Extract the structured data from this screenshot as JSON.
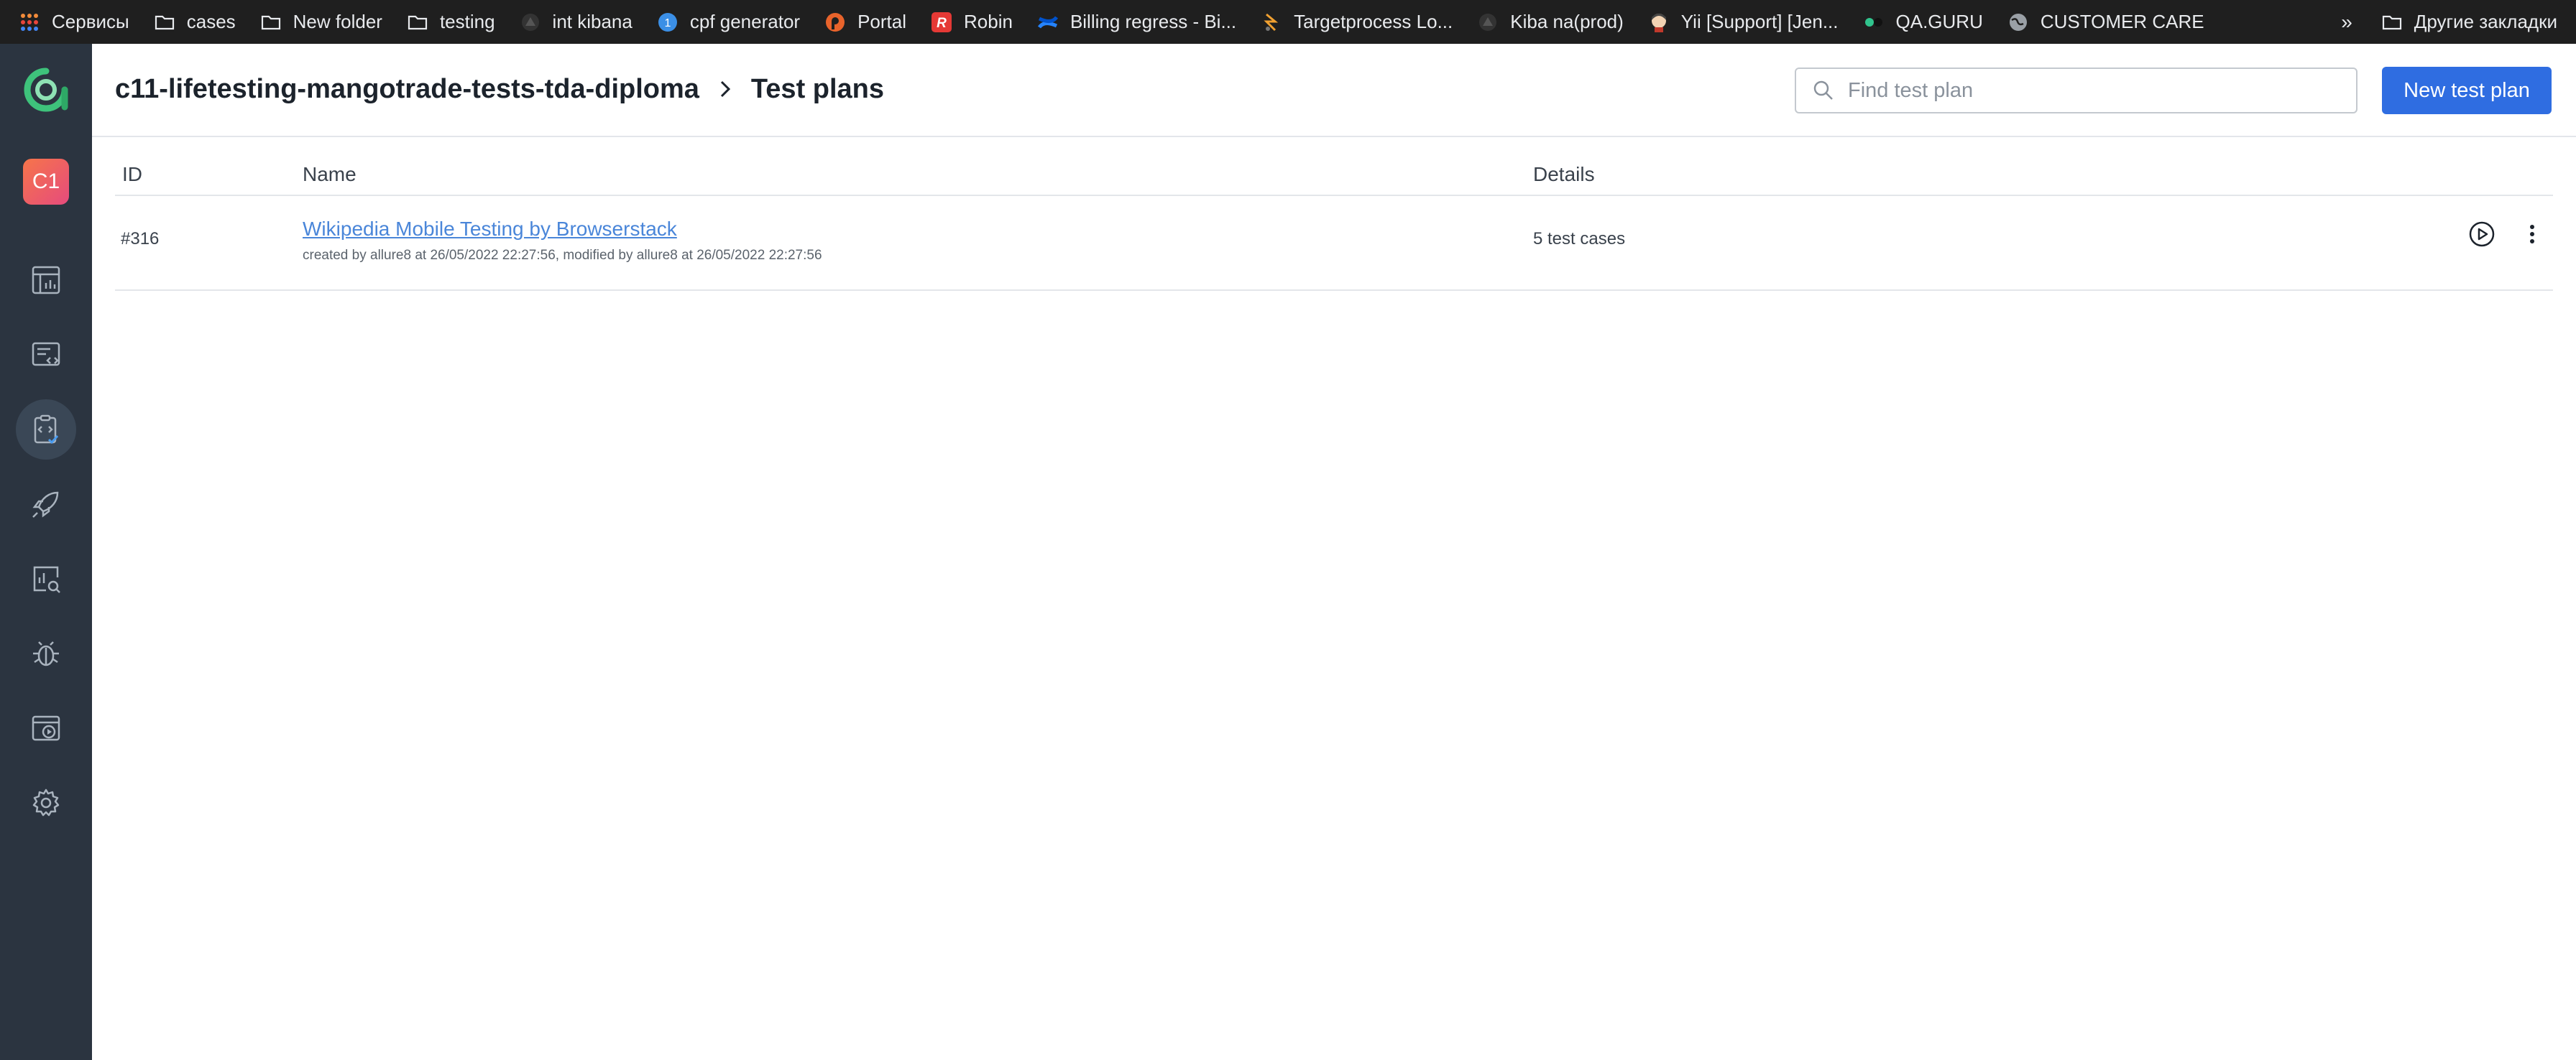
{
  "bookmarks": {
    "items": [
      {
        "label": "Сервисы",
        "icon": "apps-grid-icon"
      },
      {
        "label": "cases",
        "icon": "folder-icon"
      },
      {
        "label": "New folder",
        "icon": "folder-icon"
      },
      {
        "label": "testing",
        "icon": "folder-icon"
      },
      {
        "label": "int kibana",
        "icon": "kibana-icon"
      },
      {
        "label": "cpf generator",
        "icon": "cpf-icon"
      },
      {
        "label": "Portal",
        "icon": "portal-icon"
      },
      {
        "label": "Robin",
        "icon": "robin-icon"
      },
      {
        "label": "Billing regress - Bi...",
        "icon": "confluence-icon"
      },
      {
        "label": "Targetprocess Lo...",
        "icon": "targetprocess-icon"
      },
      {
        "label": "Kiba na(prod)",
        "icon": "kibana-icon"
      },
      {
        "label": "Yii [Support] [Jen...",
        "icon": "jenkins-icon"
      },
      {
        "label": "QA.GURU",
        "icon": "qaguru-icon"
      },
      {
        "label": "CUSTOMER CARE",
        "icon": "globe-icon"
      }
    ],
    "more": "»",
    "other_bookmarks": "Другие закладки"
  },
  "sidebar": {
    "project_avatar": "C1",
    "items": [
      {
        "name": "dashboards",
        "icon": "dashboard-icon"
      },
      {
        "name": "test-cases",
        "icon": "test-cases-icon"
      },
      {
        "name": "test-plans",
        "icon": "test-plans-icon",
        "active": true
      },
      {
        "name": "launches",
        "icon": "rocket-icon"
      },
      {
        "name": "analytics",
        "icon": "analytics-icon"
      },
      {
        "name": "defects",
        "icon": "bug-icon"
      },
      {
        "name": "jobs",
        "icon": "jobs-icon"
      },
      {
        "name": "settings",
        "icon": "gear-icon"
      }
    ]
  },
  "header": {
    "project": "c11-lifetesting-mangotrade-tests-tda-diploma",
    "page": "Test plans"
  },
  "search": {
    "placeholder": "Find test plan",
    "value": ""
  },
  "actions": {
    "new_label": "New test plan"
  },
  "table": {
    "columns": {
      "id": "ID",
      "name": "Name",
      "details": "Details"
    },
    "rows": [
      {
        "id": "#316",
        "name": "Wikipedia Mobile Testing by Browserstack",
        "meta": "created by allure8 at 26/05/2022 22:27:56, modified by allure8 at 26/05/2022 22:27:56",
        "details": "5 test cases"
      }
    ]
  },
  "colors": {
    "accent": "#2f6de1",
    "link": "#4a86d9",
    "sidebar_bg": "#2b3440",
    "bookmarks_bg": "#1f1f1f"
  }
}
